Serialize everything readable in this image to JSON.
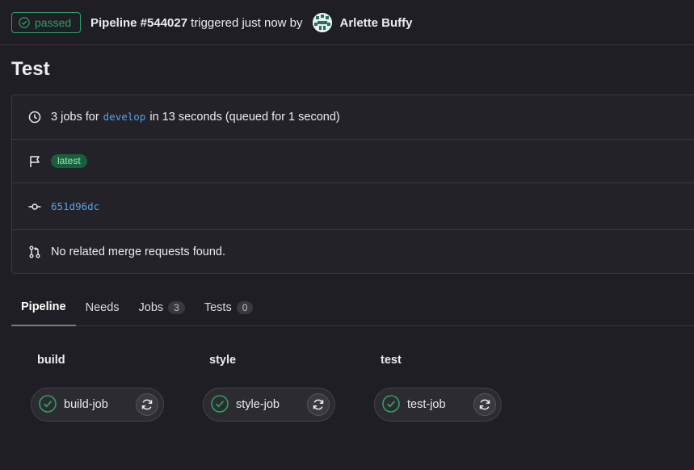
{
  "header": {
    "status": "passed",
    "pipeline_label": "Pipeline #544027",
    "triggered_text": "triggered just now by",
    "user": "Arlette Buffy"
  },
  "page_title": "Test",
  "info": {
    "jobs_prefix": "3 jobs for",
    "branch": "develop",
    "jobs_suffix": "in 13 seconds (queued for 1 second)",
    "tag": "latest",
    "commit": "651d96dc",
    "merge_requests": "No related merge requests found."
  },
  "tabs": [
    {
      "label": "Pipeline",
      "count": null
    },
    {
      "label": "Needs",
      "count": null
    },
    {
      "label": "Jobs",
      "count": "3"
    },
    {
      "label": "Tests",
      "count": "0"
    }
  ],
  "stages": [
    {
      "title": "build",
      "job": "build-job"
    },
    {
      "title": "style",
      "job": "style-job"
    },
    {
      "title": "test",
      "job": "test-job"
    }
  ],
  "colors": {
    "success": "#2da160",
    "link": "#5b9fe8",
    "background": "#1f1e24"
  },
  "icons": {
    "status": "check-circle-icon",
    "clock": "clock-icon",
    "flag": "flag-icon",
    "commit": "commit-icon",
    "merge_request": "merge-request-icon",
    "retry": "retry-icon"
  }
}
